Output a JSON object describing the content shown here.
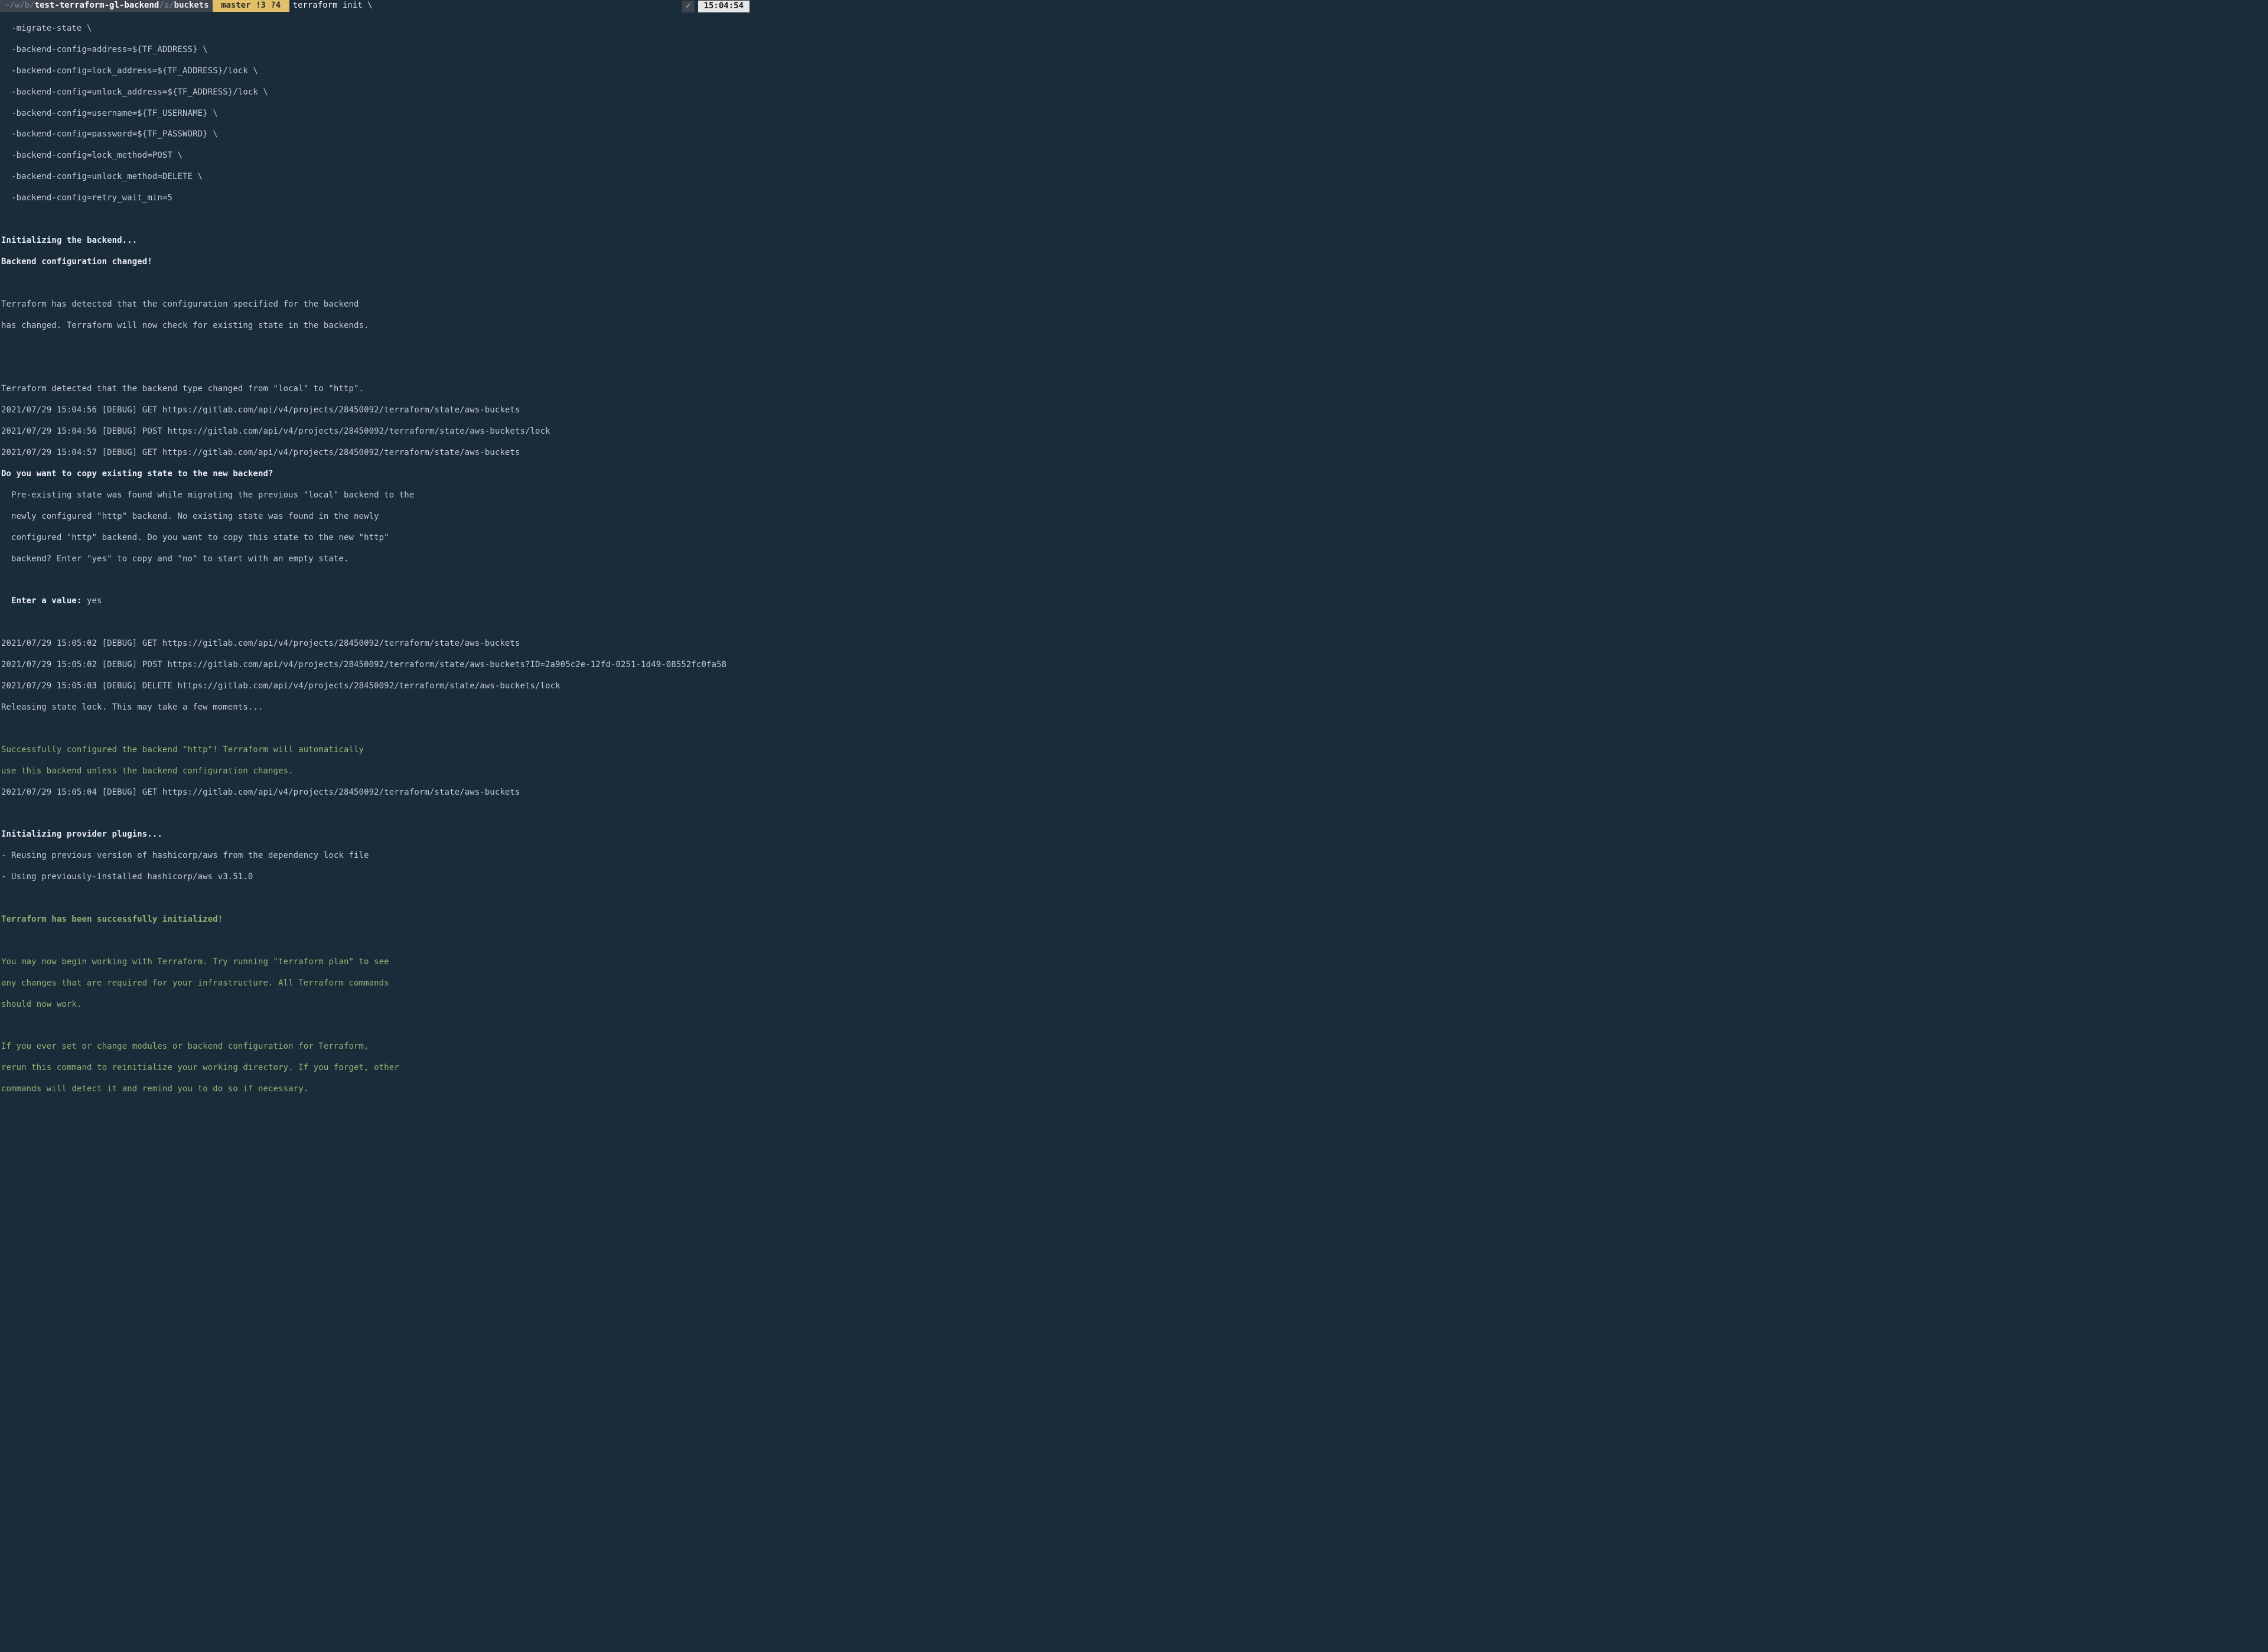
{
  "status_bar": {
    "path_prefix": "~/",
    "path_seg_a": "w",
    "path_seg_b": "b",
    "path_dir1": "test-terraform-gl-backend",
    "path_seg_c": "a",
    "path_dir2": "buckets",
    "branch": " master !3 ?4 ",
    "command_name": "terraform",
    "command_rest": " init \\",
    "check": "✓",
    "clock": "15:04:54"
  },
  "cmd_lines": [
    "  -migrate-state \\",
    "  -backend-config=address=${TF_ADDRESS} \\",
    "  -backend-config=lock_address=${TF_ADDRESS}/lock \\",
    "  -backend-config=unlock_address=${TF_ADDRESS}/lock \\",
    "  -backend-config=username=${TF_USERNAME} \\",
    "  -backend-config=password=${TF_PASSWORD} \\",
    "  -backend-config=lock_method=POST \\",
    "  -backend-config=unlock_method=DELETE \\",
    "  -backend-config=retry_wait_min=5"
  ],
  "blank": "",
  "init_backend": "Initializing the backend...",
  "backend_changed": "Backend configuration changed!",
  "detected1": "Terraform has detected that the configuration specified for the backend",
  "detected2": "has changed. Terraform will now check for existing state in the backends.",
  "detect_type": "Terraform detected that the backend type changed from \"local\" to \"http\".",
  "log1": "2021/07/29 15:04:56 [DEBUG] GET https://gitlab.com/api/v4/projects/28450092/terraform/state/aws-buckets",
  "log2": "2021/07/29 15:04:56 [DEBUG] POST https://gitlab.com/api/v4/projects/28450092/terraform/state/aws-buckets/lock",
  "log3": "2021/07/29 15:04:57 [DEBUG] GET https://gitlab.com/api/v4/projects/28450092/terraform/state/aws-buckets",
  "copy_q": "Do you want to copy existing state to the new backend?",
  "copy_exp1": "  Pre-existing state was found while migrating the previous \"local\" backend to the",
  "copy_exp2": "  newly configured \"http\" backend. No existing state was found in the newly",
  "copy_exp3": "  configured \"http\" backend. Do you want to copy this state to the new \"http\"",
  "copy_exp4": "  backend? Enter \"yes\" to copy and \"no\" to start with an empty state.",
  "enter_label": "  Enter a value:",
  "enter_value": " yes",
  "log4": "2021/07/29 15:05:02 [DEBUG] GET https://gitlab.com/api/v4/projects/28450092/terraform/state/aws-buckets",
  "log5": "2021/07/29 15:05:02 [DEBUG] POST https://gitlab.com/api/v4/projects/28450092/terraform/state/aws-buckets?ID=2a905c2e-12fd-0251-1d49-08552fc0fa58",
  "log6": "2021/07/29 15:05:03 [DEBUG] DELETE https://gitlab.com/api/v4/projects/28450092/terraform/state/aws-buckets/lock",
  "releasing": "Releasing state lock. This may take a few moments...",
  "success1": "Successfully configured the backend \"http\"! Terraform will automatically",
  "success2": "use this backend unless the backend configuration changes.",
  "log7": "2021/07/29 15:05:04 [DEBUG] GET https://gitlab.com/api/v4/projects/28450092/terraform/state/aws-buckets",
  "init_plugins": "Initializing provider plugins...",
  "plugin1": "- Reusing previous version of hashicorp/aws from the dependency lock file",
  "plugin2": "- Using previously-installed hashicorp/aws v3.51.0",
  "tf_success": "Terraform has been successfully initialized!",
  "outro1": "You may now begin working with Terraform. Try running \"terraform plan\" to see",
  "outro2": "any changes that are required for your infrastructure. All Terraform commands",
  "outro3": "should now work.",
  "outro4": "If you ever set or change modules or backend configuration for Terraform,",
  "outro5": "rerun this command to reinitialize your working directory. If you forget, other",
  "outro6": "commands will detect it and remind you to do so if necessary."
}
